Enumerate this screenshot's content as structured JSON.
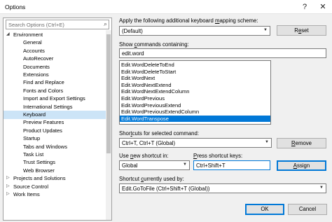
{
  "window": {
    "title": "Options",
    "help_glyph": "?",
    "close_glyph": "✕"
  },
  "search": {
    "placeholder": "Search Options (Ctrl+E)"
  },
  "tree": {
    "items": [
      {
        "label": "Environment",
        "arrow": "◢",
        "level": 0
      },
      {
        "label": "General",
        "level": 1
      },
      {
        "label": "Accounts",
        "level": 1
      },
      {
        "label": "AutoRecover",
        "level": 1
      },
      {
        "label": "Documents",
        "level": 1
      },
      {
        "label": "Extensions",
        "level": 1
      },
      {
        "label": "Find and Replace",
        "level": 1
      },
      {
        "label": "Fonts and Colors",
        "level": 1
      },
      {
        "label": "Import and Export Settings",
        "level": 1
      },
      {
        "label": "International Settings",
        "level": 1
      },
      {
        "label": "Keyboard",
        "level": 1,
        "selected": true
      },
      {
        "label": "Preview Features",
        "level": 1
      },
      {
        "label": "Product Updates",
        "level": 1
      },
      {
        "label": "Startup",
        "level": 1
      },
      {
        "label": "Tabs and Windows",
        "level": 1
      },
      {
        "label": "Task List",
        "level": 1
      },
      {
        "label": "Trust Settings",
        "level": 1
      },
      {
        "label": "Web Browser",
        "level": 1
      },
      {
        "label": "Projects and Solutions",
        "arrow": "▷",
        "level": 0
      },
      {
        "label": "Source Control",
        "arrow": "▷",
        "level": 0
      },
      {
        "label": "Work Items",
        "arrow": "▷",
        "level": 0
      }
    ]
  },
  "mapping": {
    "label_pre": "Apply the following additional keyboard ",
    "label_ul": "m",
    "label_post": "apping scheme:",
    "value": "(Default)",
    "reset_pre": "R",
    "reset_ul": "e",
    "reset_post": "set"
  },
  "show_commands": {
    "label_pre": "Show ",
    "label_ul": "c",
    "label_post": "ommands containing:",
    "value": "edit.word"
  },
  "commands": [
    "Edit.WordDeleteToEnd",
    "Edit.WordDeleteToStart",
    "Edit.WordNext",
    "Edit.WordNextExtend",
    "Edit.WordNextExtendColumn",
    "Edit.WordPrevious",
    "Edit.WordPreviousExtend",
    "Edit.WordPreviousExtendColumn",
    "Edit.WordTranspose"
  ],
  "selected_command_index": 8,
  "shortcuts_selected": {
    "label_pre": "Shor",
    "label_ul": "t",
    "label_post": "cuts for selected command:",
    "value": "Ctrl+T, Ctrl+T (Global)",
    "remove_pre": "",
    "remove_ul": "R",
    "remove_post": "emove"
  },
  "use_new_shortcut": {
    "label_pre": "Use ",
    "label_ul": "n",
    "label_post": "ew shortcut in:",
    "value": "Global"
  },
  "press_shortcut": {
    "label_pre": "",
    "label_ul": "P",
    "label_post": "ress shortcut keys:",
    "value": "Ctrl+Shift+T",
    "assign_pre": "",
    "assign_ul": "A",
    "assign_post": "ssign"
  },
  "shortcut_used_by": {
    "label_pre": "Shortcut ",
    "label_ul": "c",
    "label_post": "urrently used by:",
    "value": "Edit.GoToFile (Ctrl+Shift+T (Global))"
  },
  "footer": {
    "ok": "OK",
    "cancel": "Cancel"
  },
  "icons": {
    "search": "⌕",
    "chevron": "▼"
  },
  "colors": {
    "selection": "#0078d7",
    "tree_selection": "#cce4f7"
  }
}
